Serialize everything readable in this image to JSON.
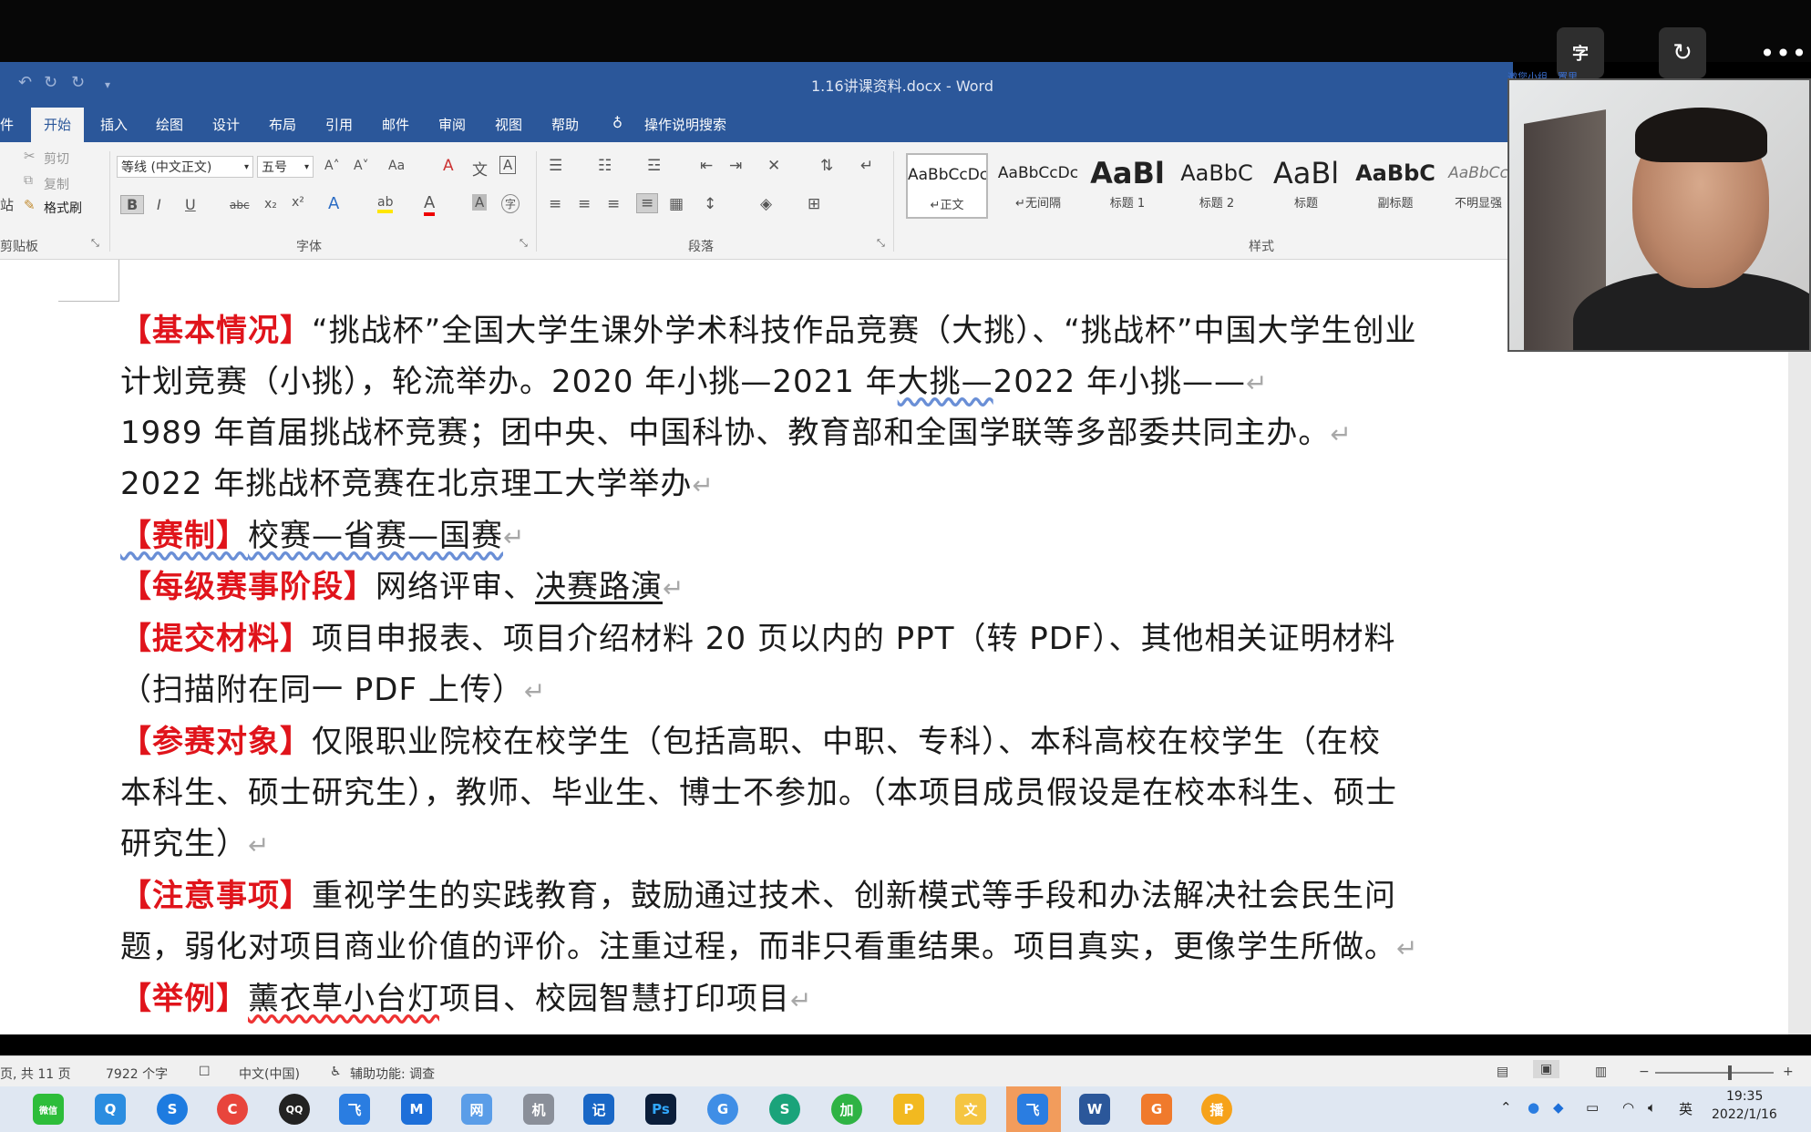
{
  "top_controls": {
    "caption": "字",
    "rotate": "↻",
    "more": "•••"
  },
  "window": {
    "title": "1.16讲课资料.docx  -  Word"
  },
  "quick_access": {
    "undo": "↶",
    "redo": "↻",
    "customize": "▾"
  },
  "tabs": [
    "开始",
    "插入",
    "绘图",
    "设计",
    "布局",
    "引用",
    "邮件",
    "审阅",
    "视图",
    "帮助"
  ],
  "tab_file_partial": "件",
  "tell_me": "操作说明搜索",
  "clipboard": {
    "cut": "剪切",
    "copy": "复制",
    "format_painter": "格式刷",
    "paste_partial": "站",
    "label": "剪贴板"
  },
  "font": {
    "name": "等线 (中文正文)",
    "size": "五号",
    "label": "字体",
    "bold": "B",
    "italic": "I",
    "underline": "U",
    "strike": "abc",
    "sub": "x₂",
    "sup": "x²",
    "grow": "A˄",
    "shrink": "A˅",
    "case": "Aa",
    "clear": "A",
    "phonetic": "文",
    "border": "A",
    "effects": "A",
    "highlight": "ab",
    "color": "A",
    "shade": "A",
    "enclose": "字"
  },
  "paragraph": {
    "label": "段落"
  },
  "styles": {
    "label": "样式",
    "items": [
      {
        "preview": "AaBbCcDc",
        "name": "↵正文"
      },
      {
        "preview": "AaBbCcDc",
        "name": "↵无间隔"
      },
      {
        "preview": "AaBl",
        "name": "标题 1"
      },
      {
        "preview": "AaBbC",
        "name": "标题 2"
      },
      {
        "preview": "AaBl",
        "name": "标题"
      },
      {
        "preview": "AaBbC",
        "name": "副标题"
      },
      {
        "preview": "AaBbCc",
        "name": "不明显强"
      }
    ]
  },
  "webcam_banner": "邀您小组…置里",
  "document": {
    "lines": [
      {
        "tag": "【基本情况】",
        "text": "“挑战杯”全国大学生课外学术科技作品竞赛（大挑）、“挑战杯”中国大学生创业"
      },
      {
        "text_a": "计划竞赛（小挑），轮流举办。2020 年小挑—2021 年",
        "text_sq": "大挑—",
        "text_b": "2022 年小挑——",
        "mark": "↵"
      },
      {
        "text": "1989 年首届挑战杯竞赛；团中央、中国科协、教育部和全国学联等多部委共同主办。",
        "mark": "↵"
      },
      {
        "text": "2022 年挑战杯竞赛在北京理工大学举办",
        "mark": "↵"
      },
      {
        "tag": "【赛制】",
        "text": "校赛—省赛—国赛",
        "mark": "↵"
      },
      {
        "tag": "【每级赛事阶段】",
        "text_a": "网络评审、",
        "text_ul": "决赛路演",
        "mark": "↵"
      },
      {
        "tag": "【提交材料】",
        "text": "项目申报表、项目介绍材料 20 页以内的 PPT（转 PDF）、其他相关证明材料"
      },
      {
        "text": "（扫描附在同一 PDF 上传）",
        "mark": "↵"
      },
      {
        "tag": "【参赛对象】",
        "text": "仅限职业院校在校学生（包括高职、中职、专科）、本科高校在校学生（在校"
      },
      {
        "text": "本科生、硕士研究生），教师、毕业生、博士不参加。（本项目成员假设是在校本科生、硕士"
      },
      {
        "text": "研究生）",
        "mark": "↵"
      },
      {
        "tag": "【注意事项】",
        "text": "重视学生的实践教育，鼓励通过技术、创新模式等手段和办法解决社会民生问"
      },
      {
        "text": "题，弱化对项目商业价值的评价。注重过程，而非只看重结果。项目真实，更像学生所做。",
        "mark": "↵"
      },
      {
        "tag": "【举例】",
        "text_sq": "薰衣草小台灯",
        "text_b": "项目、校园智慧打印项目",
        "mark": "↵"
      }
    ]
  },
  "status": {
    "pages": "页, 共 11 页",
    "words": "7922 个字",
    "language": "中文(中国)",
    "accessibility": "辅助功能: 调查"
  },
  "taskbar": {
    "apps": [
      "微信",
      "Q",
      "S",
      "C",
      "QQ",
      "飞",
      "M",
      "网",
      "机",
      "记",
      "Ps",
      "G",
      "S",
      "加",
      "P",
      "文",
      "飞",
      "W",
      "G",
      "播"
    ],
    "tray_lang": "英",
    "time": "19:35",
    "date": "2022/1/16"
  }
}
